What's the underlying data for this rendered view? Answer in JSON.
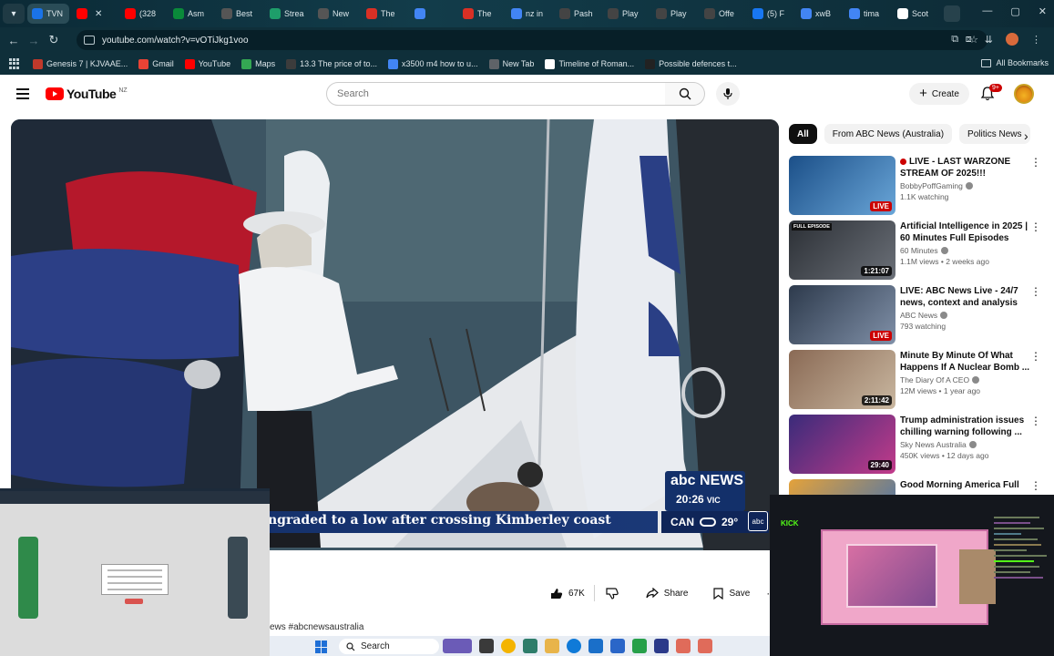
{
  "browser": {
    "tabs": [
      {
        "label": "TVN",
        "color": "#1a73e8"
      },
      {
        "label": "",
        "color": "#ff0000"
      },
      {
        "label": "(328",
        "color": "#ff0000"
      },
      {
        "label": "Asm",
        "color": "#0a8a3a"
      },
      {
        "label": "Best",
        "color": "#555555"
      },
      {
        "label": "Strea",
        "color": "#1e9e6a"
      },
      {
        "label": "New",
        "color": "#555555"
      },
      {
        "label": "The",
        "color": "#d93025"
      },
      {
        "label": "",
        "color": "#4285f4"
      },
      {
        "label": "The",
        "color": "#d93025"
      },
      {
        "label": "nz in",
        "color": "#4285f4"
      },
      {
        "label": "Pash",
        "color": "#444444"
      },
      {
        "label": "Play",
        "color": "#444444"
      },
      {
        "label": "Play",
        "color": "#444444"
      },
      {
        "label": "Offe",
        "color": "#444444"
      },
      {
        "label": "(5) F",
        "color": "#1877f2"
      },
      {
        "label": "xwB",
        "color": "#4285f4"
      },
      {
        "label": "tima",
        "color": "#4285f4"
      },
      {
        "label": "Scot",
        "color": "#ffffff"
      }
    ],
    "url": "youtube.com/watch?v=vOTiJkg1voo",
    "bookmarks": [
      {
        "label": "Genesis 7 | KJVAAE...",
        "color": "#c0392b"
      },
      {
        "label": "Gmail",
        "color": "#ea4335"
      },
      {
        "label": "YouTube",
        "color": "#ff0000"
      },
      {
        "label": "Maps",
        "color": "#34a853"
      },
      {
        "label": "13.3 The price of to...",
        "color": "#3c3c3c"
      },
      {
        "label": "x3500 m4 how to u...",
        "color": "#4285f4"
      },
      {
        "label": "New Tab",
        "color": "#5f6368"
      },
      {
        "label": "Timeline of Roman...",
        "color": "#ffffff"
      },
      {
        "label": "Possible defences t...",
        "color": "#222222"
      }
    ],
    "all_bookmarks": "All Bookmarks"
  },
  "youtube": {
    "region": "NZ",
    "search_placeholder": "Search",
    "create_label": "Create",
    "notification_count": "9+",
    "player": {
      "caption": "ngraded to a low after crossing Kimberley coast",
      "news_brand": "NEWS",
      "news_time": "20:26",
      "news_state": "VIC",
      "weather_city": "CAN",
      "weather_temp": "29°"
    },
    "actions": {
      "likes": "67K",
      "share": "Share",
      "save": "Save"
    },
    "description_snippet": "ews #abcnewsaustralia",
    "chips": [
      "All",
      "From ABC News (Australia)",
      "Politics News"
    ],
    "recommendations": [
      {
        "title": "LIVE - LAST WARZONE STREAM OF 2025!!!",
        "channel": "BobbyPoffGaming",
        "stats": "1.1K watching",
        "badge": "LIVE",
        "is_live": true,
        "thumb_label": "",
        "colors": [
          "#1b4f88",
          "#6aa6d8"
        ]
      },
      {
        "title": "Artificial Intelligence in 2025 | 60 Minutes Full Episodes",
        "channel": "60 Minutes",
        "stats": "1.1M views • 2 weeks ago",
        "badge": "1:21:07",
        "is_live": false,
        "thumb_label": "FULL EPISODE",
        "colors": [
          "#2b2f35",
          "#6b7078"
        ]
      },
      {
        "title": "LIVE: ABC News Live - 24/7 news, context and analysis",
        "channel": "ABC News",
        "stats": "793 watching",
        "badge": "LIVE",
        "is_live": true,
        "thumb_label": "",
        "colors": [
          "#2d3a4c",
          "#8090a8"
        ]
      },
      {
        "title": "Minute By Minute Of What Happens If A Nuclear Bomb ...",
        "channel": "The Diary Of A CEO",
        "stats": "12M views • 1 year ago",
        "badge": "2:11:42",
        "is_live": false,
        "thumb_label": "",
        "colors": [
          "#8a6a55",
          "#c9b7a0"
        ]
      },
      {
        "title": "Trump administration issues chilling warning following ...",
        "channel": "Sky News Australia",
        "stats": "450K views • 12 days ago",
        "badge": "29:40",
        "is_live": false,
        "thumb_label": "",
        "colors": [
          "#3a2b7a",
          "#c23b8a"
        ]
      },
      {
        "title": "Good Morning America Full",
        "channel": "",
        "stats": "",
        "badge": "",
        "is_live": false,
        "thumb_label": "",
        "colors": [
          "#e4a23a",
          "#3a6fb8"
        ]
      }
    ]
  },
  "taskbar": {
    "search_placeholder": "Search"
  },
  "stream_overlay": {
    "brand": "KICK"
  }
}
